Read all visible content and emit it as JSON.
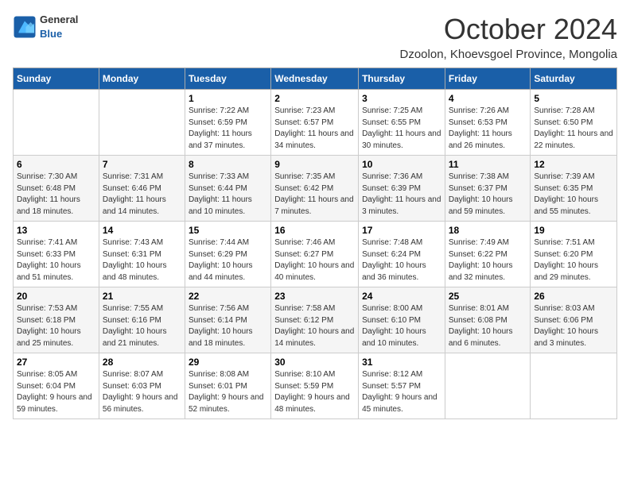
{
  "logo": {
    "general": "General",
    "blue": "Blue"
  },
  "header": {
    "month": "October 2024",
    "location": "Dzoolon, Khoevsgoel Province, Mongolia"
  },
  "weekdays": [
    "Sunday",
    "Monday",
    "Tuesday",
    "Wednesday",
    "Thursday",
    "Friday",
    "Saturday"
  ],
  "weeks": [
    [
      {
        "day": "",
        "text": ""
      },
      {
        "day": "",
        "text": ""
      },
      {
        "day": "1",
        "text": "Sunrise: 7:22 AM\nSunset: 6:59 PM\nDaylight: 11 hours\nand 37 minutes."
      },
      {
        "day": "2",
        "text": "Sunrise: 7:23 AM\nSunset: 6:57 PM\nDaylight: 11 hours\nand 34 minutes."
      },
      {
        "day": "3",
        "text": "Sunrise: 7:25 AM\nSunset: 6:55 PM\nDaylight: 11 hours\nand 30 minutes."
      },
      {
        "day": "4",
        "text": "Sunrise: 7:26 AM\nSunset: 6:53 PM\nDaylight: 11 hours\nand 26 minutes."
      },
      {
        "day": "5",
        "text": "Sunrise: 7:28 AM\nSunset: 6:50 PM\nDaylight: 11 hours\nand 22 minutes."
      }
    ],
    [
      {
        "day": "6",
        "text": "Sunrise: 7:30 AM\nSunset: 6:48 PM\nDaylight: 11 hours\nand 18 minutes."
      },
      {
        "day": "7",
        "text": "Sunrise: 7:31 AM\nSunset: 6:46 PM\nDaylight: 11 hours\nand 14 minutes."
      },
      {
        "day": "8",
        "text": "Sunrise: 7:33 AM\nSunset: 6:44 PM\nDaylight: 11 hours\nand 10 minutes."
      },
      {
        "day": "9",
        "text": "Sunrise: 7:35 AM\nSunset: 6:42 PM\nDaylight: 11 hours\nand 7 minutes."
      },
      {
        "day": "10",
        "text": "Sunrise: 7:36 AM\nSunset: 6:39 PM\nDaylight: 11 hours\nand 3 minutes."
      },
      {
        "day": "11",
        "text": "Sunrise: 7:38 AM\nSunset: 6:37 PM\nDaylight: 10 hours\nand 59 minutes."
      },
      {
        "day": "12",
        "text": "Sunrise: 7:39 AM\nSunset: 6:35 PM\nDaylight: 10 hours\nand 55 minutes."
      }
    ],
    [
      {
        "day": "13",
        "text": "Sunrise: 7:41 AM\nSunset: 6:33 PM\nDaylight: 10 hours\nand 51 minutes."
      },
      {
        "day": "14",
        "text": "Sunrise: 7:43 AM\nSunset: 6:31 PM\nDaylight: 10 hours\nand 48 minutes."
      },
      {
        "day": "15",
        "text": "Sunrise: 7:44 AM\nSunset: 6:29 PM\nDaylight: 10 hours\nand 44 minutes."
      },
      {
        "day": "16",
        "text": "Sunrise: 7:46 AM\nSunset: 6:27 PM\nDaylight: 10 hours\nand 40 minutes."
      },
      {
        "day": "17",
        "text": "Sunrise: 7:48 AM\nSunset: 6:24 PM\nDaylight: 10 hours\nand 36 minutes."
      },
      {
        "day": "18",
        "text": "Sunrise: 7:49 AM\nSunset: 6:22 PM\nDaylight: 10 hours\nand 32 minutes."
      },
      {
        "day": "19",
        "text": "Sunrise: 7:51 AM\nSunset: 6:20 PM\nDaylight: 10 hours\nand 29 minutes."
      }
    ],
    [
      {
        "day": "20",
        "text": "Sunrise: 7:53 AM\nSunset: 6:18 PM\nDaylight: 10 hours\nand 25 minutes."
      },
      {
        "day": "21",
        "text": "Sunrise: 7:55 AM\nSunset: 6:16 PM\nDaylight: 10 hours\nand 21 minutes."
      },
      {
        "day": "22",
        "text": "Sunrise: 7:56 AM\nSunset: 6:14 PM\nDaylight: 10 hours\nand 18 minutes."
      },
      {
        "day": "23",
        "text": "Sunrise: 7:58 AM\nSunset: 6:12 PM\nDaylight: 10 hours\nand 14 minutes."
      },
      {
        "day": "24",
        "text": "Sunrise: 8:00 AM\nSunset: 6:10 PM\nDaylight: 10 hours\nand 10 minutes."
      },
      {
        "day": "25",
        "text": "Sunrise: 8:01 AM\nSunset: 6:08 PM\nDaylight: 10 hours\nand 6 minutes."
      },
      {
        "day": "26",
        "text": "Sunrise: 8:03 AM\nSunset: 6:06 PM\nDaylight: 10 hours\nand 3 minutes."
      }
    ],
    [
      {
        "day": "27",
        "text": "Sunrise: 8:05 AM\nSunset: 6:04 PM\nDaylight: 9 hours\nand 59 minutes."
      },
      {
        "day": "28",
        "text": "Sunrise: 8:07 AM\nSunset: 6:03 PM\nDaylight: 9 hours\nand 56 minutes."
      },
      {
        "day": "29",
        "text": "Sunrise: 8:08 AM\nSunset: 6:01 PM\nDaylight: 9 hours\nand 52 minutes."
      },
      {
        "day": "30",
        "text": "Sunrise: 8:10 AM\nSunset: 5:59 PM\nDaylight: 9 hours\nand 48 minutes."
      },
      {
        "day": "31",
        "text": "Sunrise: 8:12 AM\nSunset: 5:57 PM\nDaylight: 9 hours\nand 45 minutes."
      },
      {
        "day": "",
        "text": ""
      },
      {
        "day": "",
        "text": ""
      }
    ]
  ]
}
